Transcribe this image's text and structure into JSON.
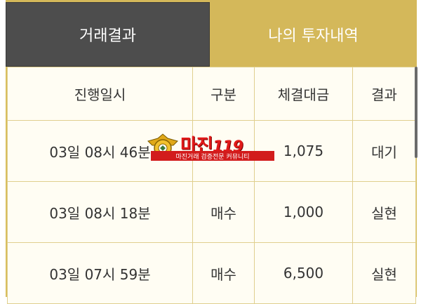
{
  "tabs": [
    {
      "label": "거래결과",
      "active": true
    },
    {
      "label": "나의 투자내역",
      "active": false
    }
  ],
  "table": {
    "headers": [
      "진행일시",
      "구분",
      "체결대금",
      "결과"
    ],
    "rows": [
      {
        "datetime": "03일 08시 46분",
        "type": "",
        "amount": "1,075",
        "result": "대기"
      },
      {
        "datetime": "03일 08시 18분",
        "type": "매수",
        "amount": "1,000",
        "result": "실현"
      },
      {
        "datetime": "03일 07시 59분",
        "type": "매수",
        "amount": "6,500",
        "result": "실현"
      }
    ]
  },
  "watermark": {
    "title": "마진",
    "number": "119",
    "subtitle": "마진거래 검증전문 커뮤니티"
  },
  "colors": {
    "active_tab": "#4d4d4d",
    "inactive_tab": "#d4b85a",
    "buy": "#c62828",
    "realized": "#c62828",
    "pending": "#9e9e9e"
  }
}
